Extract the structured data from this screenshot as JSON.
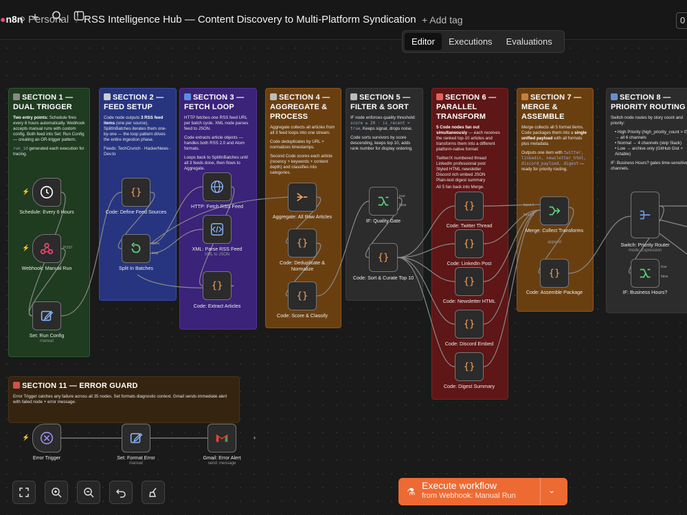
{
  "header": {
    "logo": "n8n",
    "project": "Personal",
    "workflow_title": "RSS Intelligence Hub — Content Discovery to Multi-Platform Syndication",
    "add_tag": "+ Add tag",
    "counter": "0"
  },
  "tabs": [
    "Editor",
    "Executions",
    "Evaluations"
  ],
  "sections": [
    {
      "title": "SECTION 1 — DUAL TRIGGER",
      "color": "#1f3b20",
      "p1_bold": "Two entry points:",
      "p1": " Schedule fires every 6 hours automatically. Webhook accepts manual runs with custom config. Both feed into Set: Run Config — creating an OR-trigger pattern.",
      "p2_code": "run_id",
      "p2": " generated each execution for tracing."
    },
    {
      "title": "SECTION 2 — FEED SETUP",
      "color": "#273580",
      "p1": "Code node outputs ",
      "p1_bold": "3 RSS feed items",
      "p1b": " (one per source). SplitInBatches iterates them one-by-one — the loop pattern drives the entire ingestion phase.",
      "p2": "Feeds: TechCrunch · HackerNews · Dev.to"
    },
    {
      "title": "SECTION 3 — FETCH LOOP",
      "color": "#3a2379",
      "p1": "HTTP fetches one RSS feed URL per batch cycle. XML node parses feed to JSON.",
      "p2": "Code extracts article objects — handles both RSS 2.0 and Atom formats.",
      "p3": "Loops back to SplitInBatches until all 3 feeds done, then flows to Aggregate."
    },
    {
      "title": "SECTION 4 — AGGREGATE & PROCESS",
      "color": "#6a3f10",
      "p1": "Aggregate collects all articles from all 3 feed loops into one stream.",
      "p2": "Code deduplicates by URL + normalizes timestamps.",
      "p3": "Second Code scores each article (recency + keywords + content depth) and classifies into categories."
    },
    {
      "title": "SECTION 5 — FILTER & SORT",
      "color": "#2c2c2c",
      "p1": "IF node enforces quality threshold: ",
      "p1_code": "score ≥ 20 · is_recent = true",
      "p1b": ". Keeps signal, drops noise.",
      "p2": "Code sorts survivors by score descending, keeps top 10, adds rank number for display ordering."
    },
    {
      "title": "SECTION 6 — PARALLEL TRANSFORM",
      "color": "#5e1616",
      "p1_bold": "5 Code nodes fan out simultaneously",
      "p1": " — each receives the ranked top-10 articles and transforms them into a different platform-native format:",
      "items": [
        "Twitter/X numbered thread",
        "LinkedIn professional post",
        "Styled HTML newsletter",
        "Discord rich embed JSON",
        "Plain-text digest summary"
      ],
      "p3": "All 5 fan back into Merge."
    },
    {
      "title": "SECTION 7 — MERGE & ASSEMBLE",
      "color": "#6a3f10",
      "p1": "Merge collects all 5 format items. Code packages them into a ",
      "p1_bold": "single unified payload",
      "p1b": " with all formats plus metadata.",
      "p2": "Outputs one item with ",
      "p2_code": "twitter, linkedin, newsletter_html, discord_payload, digest",
      "p2b": " — ready for priority routing."
    },
    {
      "title": "SECTION 8 — PRIORITY ROUTING",
      "color": "#2c2c2c",
      "p1": "Switch node routes by story count and priority:",
      "items": [
        "High Priority (high_priority_count > 0) → all 6 channels",
        "Normal → 4 channels (skip Slack)",
        "Low → archive only (GitHub Gist + Airtable)"
      ],
      "p3": "IF: Business Hours? gates time-sensitive channels."
    },
    {
      "title": "SECTION 11 — ERROR GUARD",
      "color": "#352410",
      "p1": "Error Trigger catches any failure across all 35 nodes. Set formats diagnostic context. Gmail sends immediate alert with failed node + error message."
    }
  ],
  "nodes": {
    "schedule": {
      "label": "Schedule: Every 6 Hours"
    },
    "webhook": {
      "label": "Webhook: Manual Run",
      "port": "POST"
    },
    "set_config": {
      "label": "Set: Run Config",
      "sub": "manual"
    },
    "define_feeds": {
      "label": "Code: Define Feed Sources"
    },
    "split": {
      "label": "Split In Batches",
      "port_done": "done",
      "port_loop": "loop"
    },
    "http": {
      "label": "HTTP: Fetch RSS Feed"
    },
    "xml": {
      "label": "XML: Parse RSS Feed",
      "sub": "XML to JSON"
    },
    "extract": {
      "label": "Code: Extract Articles"
    },
    "aggregate": {
      "label": "Aggregate: All Raw Articles"
    },
    "dedupe": {
      "label": "Code: Deduplicate & Normalize"
    },
    "score": {
      "label": "Code: Score & Classify"
    },
    "if_quality": {
      "label": "IF: Quality Gate",
      "port_true": "true",
      "port_false": "false"
    },
    "sort": {
      "label": "Code: Sort & Curate Top 10"
    },
    "twitter": {
      "label": "Code: Twitter Thread"
    },
    "linkedin": {
      "label": "Code: LinkedIn Post"
    },
    "newsletter": {
      "label": "Code: Newsletter HTML"
    },
    "discord": {
      "label": "Code: Discord Embed"
    },
    "digest": {
      "label": "Code: Digest Summary"
    },
    "merge": {
      "label": "Merge: Collect Transforms",
      "sub": "append",
      "in1": "Input 1",
      "in2": "Input 2"
    },
    "assemble": {
      "label": "Code: Assemble Package"
    },
    "switch": {
      "label": "Switch: Priority Router",
      "sub": "mode: Expression"
    },
    "if_hours": {
      "label": "IF: Business Hours?",
      "port_true": "true",
      "port_false": "false"
    },
    "error_trigger": {
      "label": "Error Trigger"
    },
    "set_error": {
      "label": "Set: Format Error",
      "sub": "manual"
    },
    "gmail": {
      "label": "Gmail: Error Alert",
      "sub": "send: message"
    }
  },
  "execute": {
    "label": "Execute workflow",
    "sub": "from Webhook: Manual Run"
  },
  "colors": {
    "accent": "#ee6a33",
    "brand": "#ea4b71"
  }
}
